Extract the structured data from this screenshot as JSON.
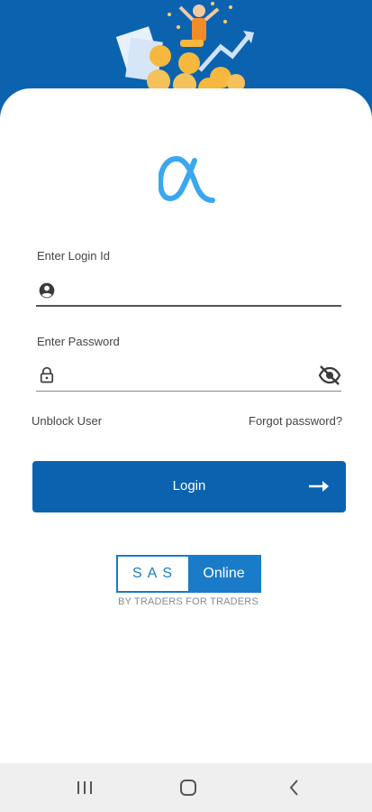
{
  "login": {
    "id_label": "Enter Login Id",
    "id_value": "",
    "password_label": "Enter Password",
    "password_value": "",
    "unblock_link": "Unblock User",
    "forgot_link": "Forgot password?",
    "login_button": "Login"
  },
  "brand": {
    "sas_left": "SAS",
    "sas_right": "Online",
    "tagline": "BY TRADERS FOR TRADERS"
  },
  "colors": {
    "primary": "#0b63b0",
    "logo": "#3aa7ee",
    "sas_blue": "#1a7bc8"
  },
  "icons": {
    "user": "account-circle-icon",
    "lock": "lock-icon",
    "visibility": "eye-off-icon",
    "arrow": "arrow-right-icon"
  }
}
